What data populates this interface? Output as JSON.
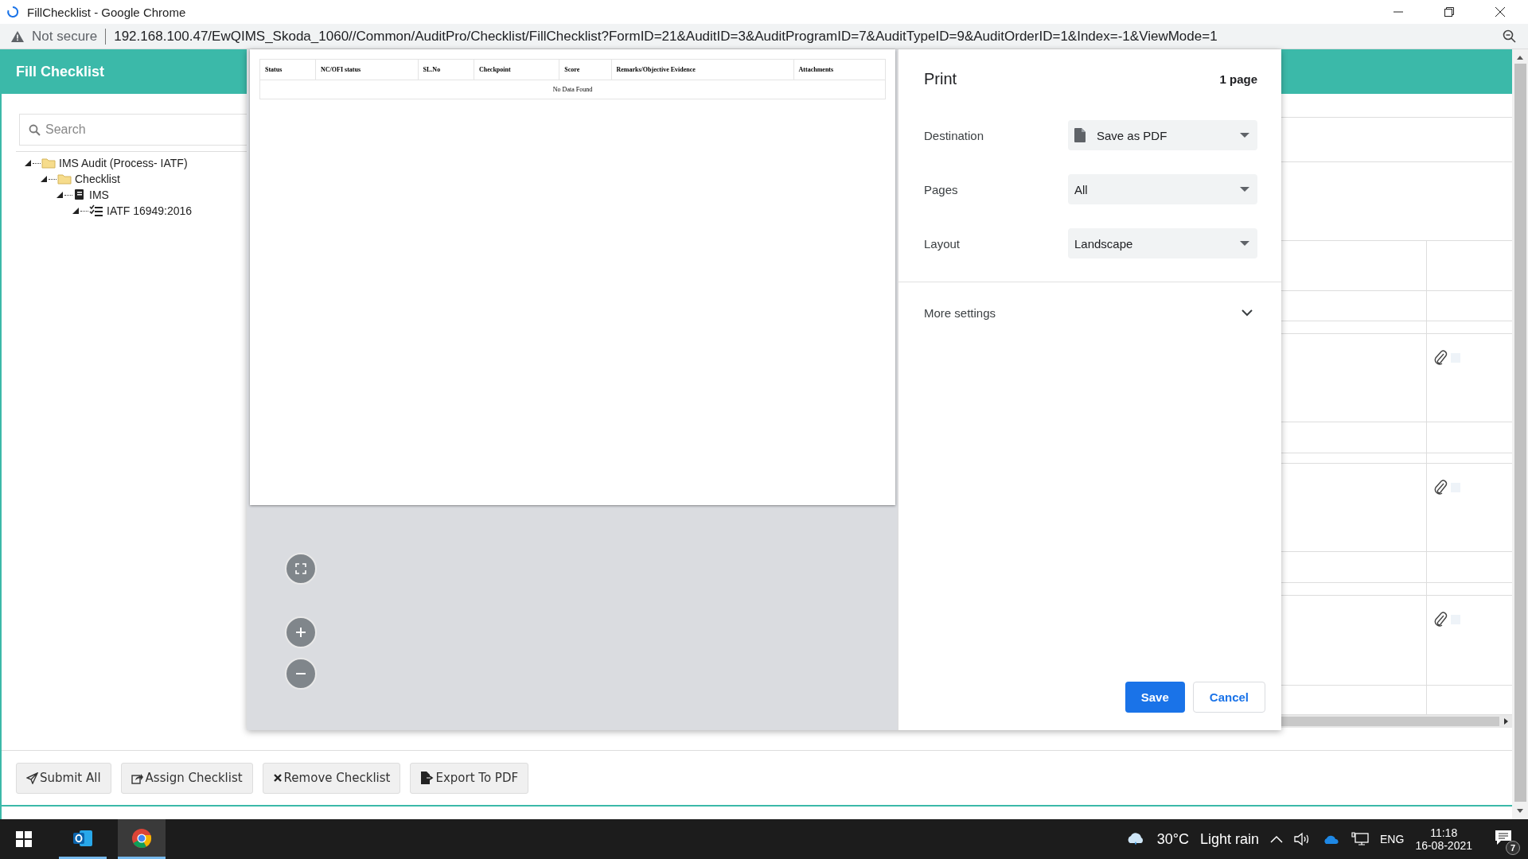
{
  "window": {
    "title": "FillChecklist - Google Chrome"
  },
  "address_bar": {
    "security": "Not secure",
    "url": "192.168.100.47/EwQIMS_Skoda_1060//Common/AuditPro/Checklist/FillChecklist?FormID=21&AuditID=3&AuditProgramID=7&AuditTypeID=9&AuditOrderID=1&Index=-1&ViewMode=1"
  },
  "app": {
    "title": "Fill Checklist",
    "search": {
      "placeholder": "Search"
    },
    "tree": [
      {
        "label": "IMS Audit (Process- IATF)",
        "kind": "folder",
        "expanded": true,
        "children": [
          {
            "label": "Checklist",
            "kind": "folder",
            "expanded": true,
            "children": [
              {
                "label": "IMS",
                "kind": "book",
                "expanded": true,
                "children": [
                  {
                    "label": "IATF 16949:2016",
                    "kind": "checklist",
                    "expanded": true
                  }
                ]
              }
            ]
          }
        ]
      }
    ],
    "buttons": [
      {
        "label": "Submit All",
        "kind": "submit"
      },
      {
        "label": "Assign Checklist",
        "kind": "assign"
      },
      {
        "label": "Remove Checklist",
        "kind": "remove"
      },
      {
        "label": "Export To PDF",
        "kind": "export"
      }
    ]
  },
  "print_preview": {
    "table": {
      "columns": [
        "Status",
        "NC/OFI status",
        "SL.No",
        "Checkpoint",
        "Score",
        "Remarks/Objective Evidence",
        "Attachments"
      ],
      "empty_message": "No Data Found"
    }
  },
  "print_dialog": {
    "title": "Print",
    "page_count": "1 page",
    "settings": [
      {
        "label": "Destination",
        "value": "Save as PDF",
        "kind": "destination"
      },
      {
        "label": "Pages",
        "value": "All",
        "kind": "select"
      },
      {
        "label": "Layout",
        "value": "Landscape",
        "kind": "select"
      }
    ],
    "more_settings": {
      "label": "More settings",
      "expanded": false
    },
    "buttons": [
      {
        "label": "Save",
        "kind": "primary"
      },
      {
        "label": "Cancel",
        "kind": "secondary"
      }
    ]
  },
  "taskbar": {
    "apps": [
      {
        "kind": "outlook",
        "selected": false
      },
      {
        "kind": "chrome",
        "selected": true
      }
    ],
    "temperature": "30°C",
    "condition": "Light rain",
    "language": "ENG",
    "time": "11:18",
    "date": "16-08-2021",
    "notification_count": "7"
  }
}
